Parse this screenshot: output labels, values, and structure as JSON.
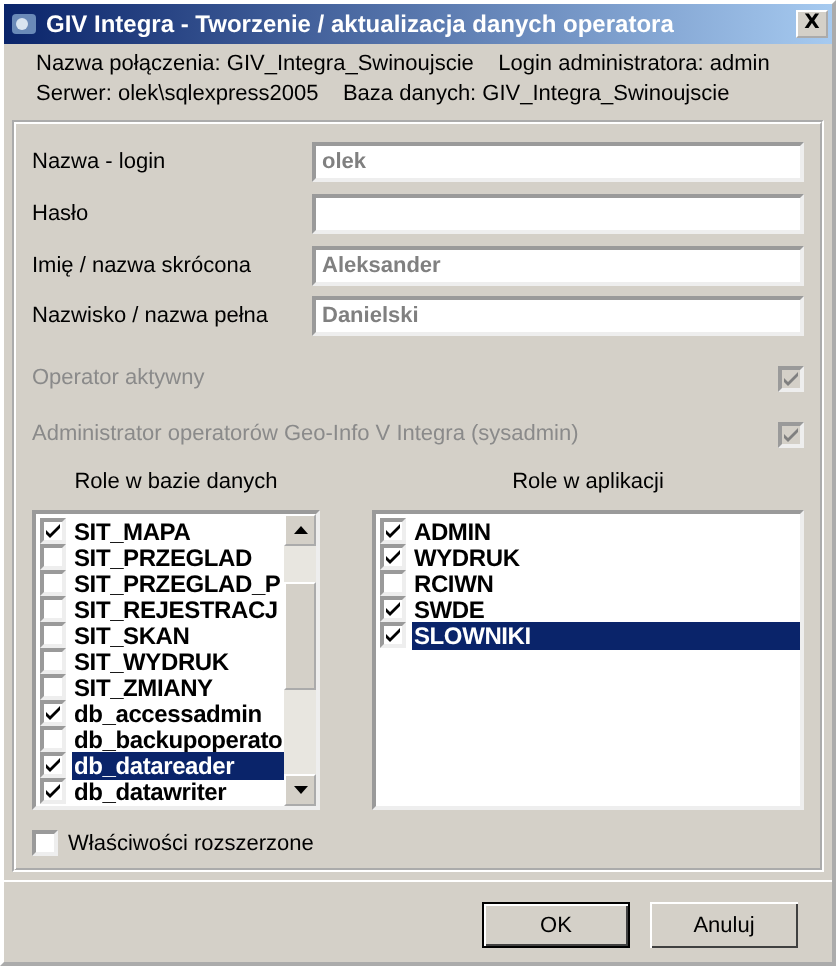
{
  "window": {
    "title": "GIV Integra - Tworzenie / aktualizacja danych operatora",
    "close": "X"
  },
  "info": [
    "Nazwa połączenia: GIV_Integra_Swinoujscie    Login administratora: admin",
    "Serwer: olek\\sqlexpress2005    Baza danych: GIV_Integra_Swinoujscie"
  ],
  "fields": [
    {
      "label": "Nazwa - login",
      "value": "olek"
    },
    {
      "label": "Hasło"
    },
    {
      "label": "Imię / nazwa skrócona",
      "value": "Aleksander"
    },
    {
      "label": "Nazwisko / nazwa pełna",
      "value": "Danielski"
    }
  ],
  "options": [
    {
      "label": "Operator aktywny",
      "checked": true,
      "disabled": true
    },
    {
      "label": "Administrator operatorów Geo-Info V Integra (sysadmin)",
      "checked": true,
      "disabled": true
    }
  ],
  "db_roles": {
    "title": "Role w bazie danych",
    "items": [
      {
        "label": "SIT_MAPA",
        "checked": true,
        "selected": false
      },
      {
        "label": "SIT_PRZEGLAD",
        "checked": false,
        "selected": false
      },
      {
        "label": "SIT_PRZEGLAD_P",
        "checked": false,
        "selected": false
      },
      {
        "label": "SIT_REJESTRACJ",
        "checked": false,
        "selected": false
      },
      {
        "label": "SIT_SKAN",
        "checked": false,
        "selected": false
      },
      {
        "label": "SIT_WYDRUK",
        "checked": false,
        "selected": false
      },
      {
        "label": "SIT_ZMIANY",
        "checked": false,
        "selected": false
      },
      {
        "label": "db_accessadmin",
        "checked": true,
        "selected": false
      },
      {
        "label": "db_backupoperato",
        "checked": false,
        "selected": false
      },
      {
        "label": "db_datareader",
        "checked": true,
        "selected": true
      },
      {
        "label": "db_datawriter",
        "checked": true,
        "selected": false
      }
    ]
  },
  "app_roles": {
    "title": "Role w aplikacji",
    "items": [
      {
        "label": "ADMIN",
        "checked": true,
        "selected": false
      },
      {
        "label": "WYDRUK",
        "checked": true,
        "selected": false
      },
      {
        "label": "RCIWN",
        "checked": false,
        "selected": false
      },
      {
        "label": "SWDE",
        "checked": true,
        "selected": false
      },
      {
        "label": "SLOWNIKI",
        "checked": true,
        "selected": true
      }
    ]
  },
  "extended": {
    "label": "Właściwości rozszerzone",
    "checked": false
  },
  "buttons": [
    {
      "label": "OK",
      "default": true
    },
    {
      "label": "Anuluj",
      "default": false
    }
  ]
}
